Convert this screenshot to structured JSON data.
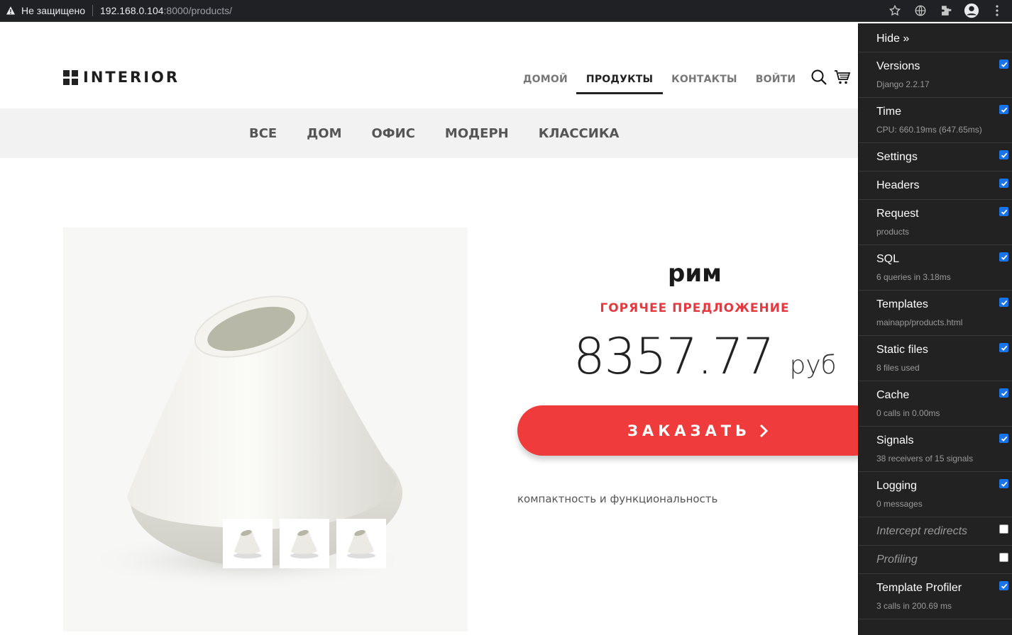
{
  "browser": {
    "security": "Не защищено",
    "url_host": "192.168.0.104",
    "url_rest": ":8000/products/"
  },
  "site": {
    "logo": "INTERIOR",
    "nav": [
      "ДОМОЙ",
      "ПРОДУКТЫ",
      "КОНТАКТЫ",
      "ВОЙТИ"
    ],
    "nav_active": "ПРОДУКТЫ",
    "categories": [
      "ВСЕ",
      "ДОМ",
      "ОФИС",
      "МОДЕРН",
      "КЛАССИКА"
    ]
  },
  "product": {
    "title": "рим",
    "offer": "ГОРЯЧЕЕ ПРЕДЛОЖЕНИЕ",
    "price": "8357.77",
    "currency": "руб",
    "order_label": "ЗАКАЗАТЬ",
    "description": "компактность и функциональность",
    "thumbnail_count": 3
  },
  "debug_toolbar": {
    "hide_label": "Hide »",
    "panels": [
      {
        "name": "Versions",
        "sub": "Django 2.2.17",
        "checked": true
      },
      {
        "name": "Time",
        "sub": "CPU: 660.19ms (647.65ms)",
        "checked": true
      },
      {
        "name": "Settings",
        "sub": "",
        "checked": true
      },
      {
        "name": "Headers",
        "sub": "",
        "checked": true
      },
      {
        "name": "Request",
        "sub": "products",
        "checked": true
      },
      {
        "name": "SQL",
        "sub": "6 queries in 3.18ms",
        "checked": true
      },
      {
        "name": "Templates",
        "sub": "mainapp/products.html",
        "checked": true
      },
      {
        "name": "Static files",
        "sub": "8 files used",
        "checked": true
      },
      {
        "name": "Cache",
        "sub": "0 calls in 0.00ms",
        "checked": true
      },
      {
        "name": "Signals",
        "sub": "38 receivers of 15 signals",
        "checked": true
      },
      {
        "name": "Logging",
        "sub": "0 messages",
        "checked": true
      },
      {
        "name": "Intercept redirects",
        "sub": "",
        "checked": false
      },
      {
        "name": "Profiling",
        "sub": "",
        "checked": false
      },
      {
        "name": "Template Profiler",
        "sub": "3 calls in 200.69 ms",
        "checked": true
      }
    ]
  },
  "colors": {
    "accent": "#ef3b3b",
    "offer": "#e43a3f",
    "toolbar_bg": "#222222"
  }
}
